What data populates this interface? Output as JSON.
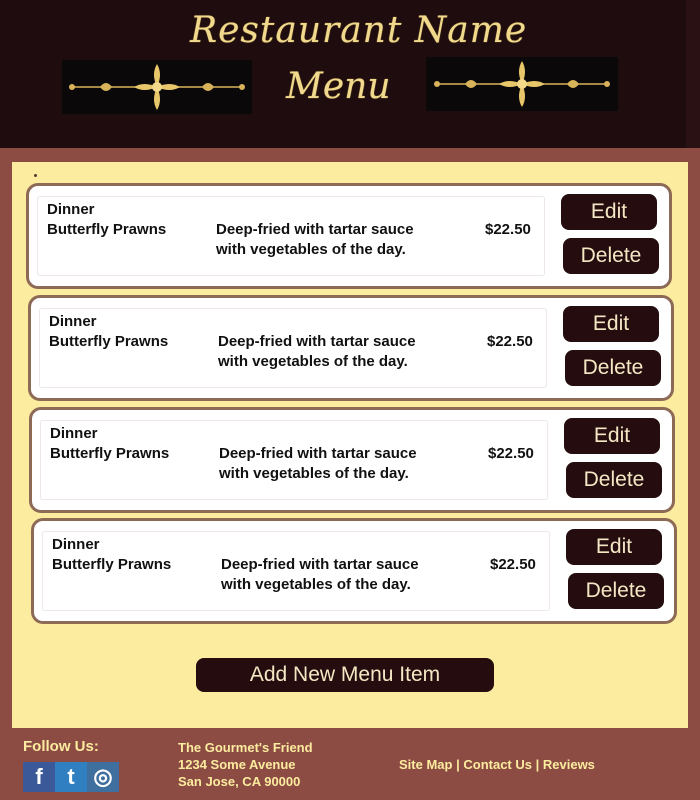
{
  "header": {
    "title": "Restaurant Name",
    "subtitle": "Menu"
  },
  "menu_items": [
    {
      "category": "Dinner",
      "name": "Butterfly Prawns",
      "desc_line1": "Deep-fried with tartar sauce",
      "desc_line2": "with vegetables of the day.",
      "price": "$22.50",
      "edit_label": "Edit",
      "delete_label": "Delete"
    },
    {
      "category": "Dinner",
      "name": "Butterfly Prawns",
      "desc_line1": "Deep-fried with tartar sauce",
      "desc_line2": "with vegetables of the day.",
      "price": "$22.50",
      "edit_label": "Edit",
      "delete_label": "Delete"
    },
    {
      "category": "Dinner",
      "name": "Butterfly Prawns",
      "desc_line1": "Deep-fried with tartar sauce",
      "desc_line2": "with vegetables of the day.",
      "price": "$22.50",
      "edit_label": "Edit",
      "delete_label": "Delete"
    },
    {
      "category": "Dinner",
      "name": "Butterfly Prawns",
      "desc_line1": "Deep-fried with tartar sauce",
      "desc_line2": "with vegetables of the day.",
      "price": "$22.50",
      "edit_label": "Edit",
      "delete_label": "Delete"
    }
  ],
  "add_button_label": "Add New Menu Item",
  "footer": {
    "follow_label": "Follow Us:",
    "social": {
      "facebook": "f",
      "twitter": "t",
      "instagram": "◎"
    },
    "address_line1": "The Gourmet's Friend",
    "address_line2": "1234 Some Avenue",
    "address_line3": "San Jose, CA  90000",
    "links": [
      "Site Map",
      "Contact Us",
      "Reviews"
    ],
    "separator": "|"
  },
  "colors": {
    "header_bg": "#1e0c0e",
    "page_bg": "#8d4c43",
    "panel_bg": "#fcec9f",
    "button_bg": "#250d0f",
    "gold": "#f0d98c"
  }
}
